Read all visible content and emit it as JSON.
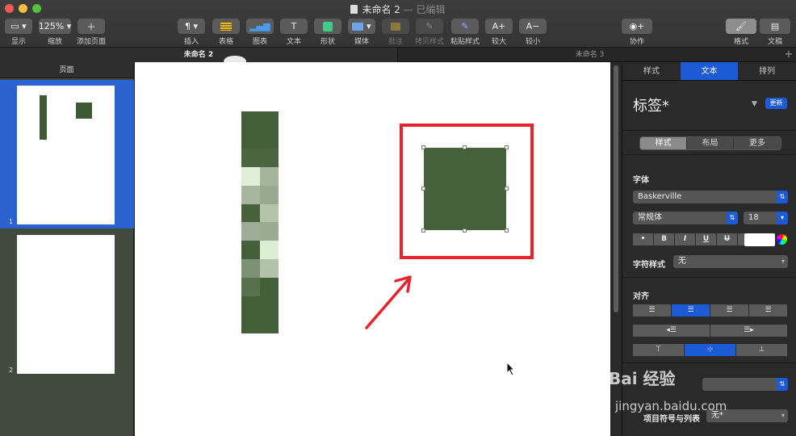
{
  "window": {
    "title": "未命名 2",
    "edited_suffix": "— 已编辑",
    "traffic_lights": {
      "close": "#ee5c55",
      "minimize": "#f6bd3e",
      "zoom": "#53c140"
    }
  },
  "toolbar": {
    "items": [
      {
        "id": "view",
        "label": "显示",
        "icon": "sidebar-view-icon"
      },
      {
        "id": "zoom",
        "label": "缩放",
        "value": "125%"
      },
      {
        "id": "add-page",
        "label": "添加页面",
        "icon": "plus-icon"
      },
      {
        "id": "insert",
        "label": "插入",
        "icon": "pilcrow-icon"
      },
      {
        "id": "table",
        "label": "表格",
        "icon": "table-icon"
      },
      {
        "id": "chart",
        "label": "图表",
        "icon": "chart-icon"
      },
      {
        "id": "text",
        "label": "文本",
        "icon": "text-icon"
      },
      {
        "id": "shape",
        "label": "形状",
        "icon": "shape-icon"
      },
      {
        "id": "media",
        "label": "媒体",
        "icon": "media-icon"
      },
      {
        "id": "comment",
        "label": "批注",
        "icon": "comment-icon"
      },
      {
        "id": "copy-style",
        "label": "拷贝样式",
        "icon": "eyedropper-icon"
      },
      {
        "id": "paste-style",
        "label": "粘贴样式",
        "icon": "paste-style-icon"
      },
      {
        "id": "bigger",
        "label": "较大",
        "glyph": "A+"
      },
      {
        "id": "smaller",
        "label": "较小",
        "glyph": "A−"
      },
      {
        "id": "collaborate",
        "label": "协作",
        "icon": "collaborate-icon"
      },
      {
        "id": "format",
        "label": "格式",
        "icon": "paintbrush-icon"
      },
      {
        "id": "document",
        "label": "文稿",
        "icon": "document-icon"
      }
    ]
  },
  "tabs": [
    {
      "label": "未命名 2",
      "active": true
    },
    {
      "label": "未命名 3",
      "active": false
    }
  ],
  "pages_sidebar": {
    "header": "页面",
    "pages": [
      {
        "number": "1",
        "selected": true
      },
      {
        "number": "2",
        "selected": false
      }
    ]
  },
  "canvas": {
    "shape_color": "#44613a",
    "highlight_color": "#e8232c",
    "mosaic_colors": [
      "#44603a",
      "#44603a",
      "#44603a",
      "#44603a",
      "#4a653f",
      "#4a653f",
      "#dfeed8",
      "#a3b59a",
      "#a7b49f",
      "#98a891",
      "#48613d",
      "#b3c4aa",
      "#9eac97",
      "#9aab92",
      "#43603a",
      "#dceed4",
      "#7c9171",
      "#b3c3a9",
      "#58704d",
      "#44603a",
      "#44603a",
      "#44603a",
      "#44603a",
      "#44603a"
    ]
  },
  "inspector": {
    "tabs": [
      {
        "label": "样式",
        "active": false
      },
      {
        "label": "文本",
        "active": true
      },
      {
        "label": "排列",
        "active": false
      }
    ],
    "paragraph_style": "标签*",
    "update_label": "更新",
    "segments": [
      {
        "label": "样式",
        "active": true
      },
      {
        "label": "布局",
        "active": false
      },
      {
        "label": "更多",
        "active": false
      }
    ],
    "font": {
      "section_label": "字体",
      "family": "Baskerville",
      "typeface": "常规体",
      "size": "18",
      "bullets_glyph": "•",
      "bold": "B",
      "italic": "I",
      "underline": "U",
      "strike": "U",
      "gear_glyph": "⚙"
    },
    "char_style": {
      "label": "字符样式",
      "value": "无"
    },
    "alignment": {
      "label": "对齐"
    },
    "bullets": {
      "label": "项目符号与列表",
      "value": "无*"
    }
  },
  "watermark": {
    "brand": "Bai 经验",
    "url": "jingyan.baidu.com"
  }
}
